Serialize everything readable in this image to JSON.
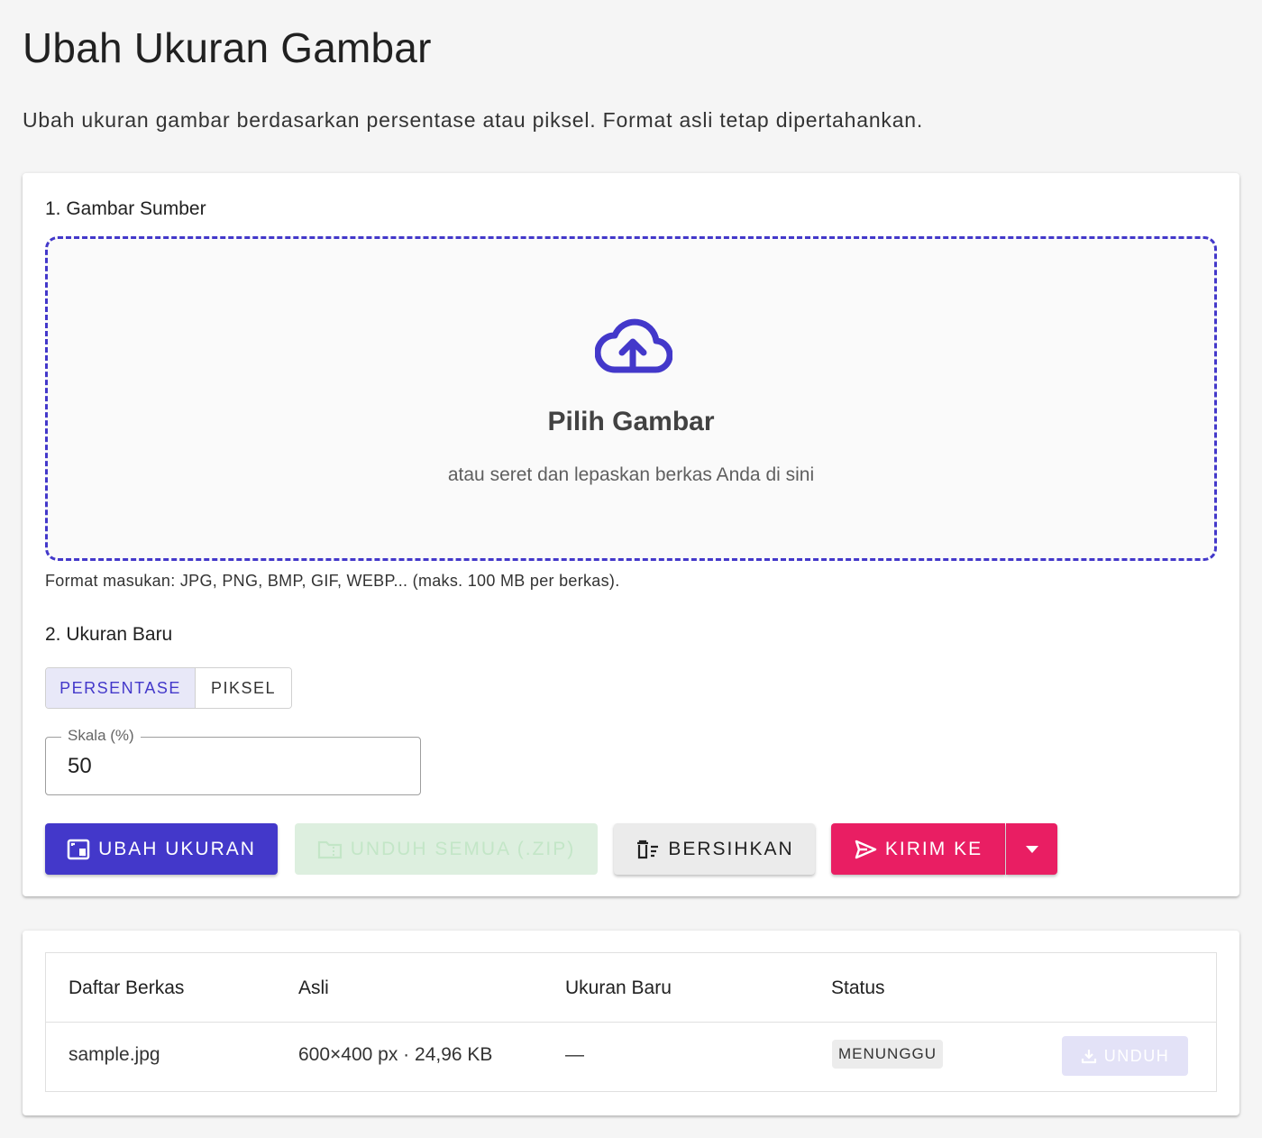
{
  "header": {
    "title": "Ubah Ukuran Gambar",
    "subtitle": "Ubah ukuran gambar berdasarkan persentase atau piksel. Format asli tetap dipertahankan."
  },
  "source": {
    "section_title": "1. Gambar Sumber",
    "dropzone_title": "Pilih Gambar",
    "dropzone_hint": "atau seret dan lepaskan berkas Anda di sini",
    "format_note": "Format masukan: JPG, PNG, BMP, GIF, WEBP... (maks. 100 MB per berkas).",
    "icon": "cloud-upload-icon"
  },
  "size": {
    "section_title": "2. Ukuran Baru",
    "modes": [
      "PERSENTASE",
      "PIKSEL"
    ],
    "active_mode": "PERSENTASE",
    "scale_label": "Skala (%)",
    "scale_value": "50"
  },
  "actions": {
    "resize_label": "UBAH UKURAN",
    "zip_label": "UNDUH SEMUA (.ZIP)",
    "clear_label": "BERSIHKAN",
    "send_label": "KIRIM KE"
  },
  "files": {
    "headers": [
      "Daftar Berkas",
      "Asli",
      "Ukuran Baru",
      "Status"
    ],
    "rows": [
      {
        "name": "sample.jpg",
        "original": "600×400 px · 24,96 KB",
        "new_size": "—",
        "status": "MENUNGGU",
        "download_label": "UNDUH"
      }
    ]
  },
  "colors": {
    "primary": "#4338ca",
    "pink": "#e91e63",
    "zip_disabled_bg": "#ddefdf",
    "background": "#f5f5f5"
  }
}
